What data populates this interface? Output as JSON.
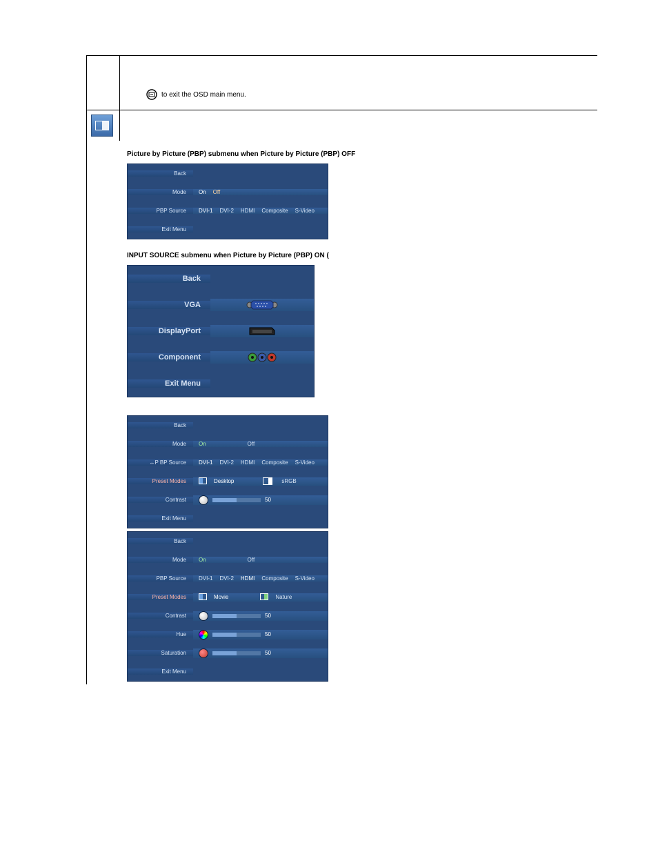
{
  "exit_line_text": "to exit the OSD main menu.",
  "heading_off": "Picture by Picture (PBP) submenu when Picture by Picture (PBP) OFF",
  "heading_on": "INPUT SOURCE submenu when Picture by Picture (PBP) ON (",
  "osd_off": {
    "rows": {
      "back": "Back",
      "mode": "Mode",
      "mode_on": "On",
      "mode_off": "Off",
      "pbp_source": "PBP Source",
      "src_dvi1": "DVI-1",
      "src_dvi2": "DVI-2",
      "src_hdmi": "HDMI",
      "src_composite": "Composite",
      "src_svideo": "S-Video",
      "exit": "Exit Menu"
    }
  },
  "osd_input": {
    "back": "Back",
    "vga": "VGA",
    "displayport": "DisplayPort",
    "component": "Component",
    "exit": "Exit Menu"
  },
  "osd_on_a": {
    "back": "Back",
    "mode": "Mode",
    "mode_on": "On",
    "mode_off": "Off",
    "pbp_source": "BP Source",
    "src_dvi1": "DVI-1",
    "src_dvi2": "DVI-2",
    "src_hdmi": "HDMI",
    "src_composite": "Composite",
    "src_svideo": "S-Video",
    "preset_modes": "Preset Modes",
    "preset_desktop": "Desktop",
    "preset_srgb": "sRGB",
    "contrast": "Contrast",
    "contrast_val": "50",
    "exit": "Exit Menu"
  },
  "osd_on_b": {
    "back": "Back",
    "mode": "Mode",
    "mode_on": "On",
    "mode_off": "Off",
    "pbp_source": "PBP Source",
    "src_dvi1": "DVI-1",
    "src_dvi2": "DVI-2",
    "src_hdmi": "HDMI",
    "src_composite": "Composite",
    "src_svideo": "S-Video",
    "preset_modes": "Preset Modes",
    "preset_movie": "Movie",
    "preset_nature": "Nature",
    "contrast": "Contrast",
    "contrast_val": "50",
    "hue": "Hue",
    "hue_val": "50",
    "saturation": "Saturation",
    "saturation_val": "50",
    "exit": "Exit Menu"
  }
}
